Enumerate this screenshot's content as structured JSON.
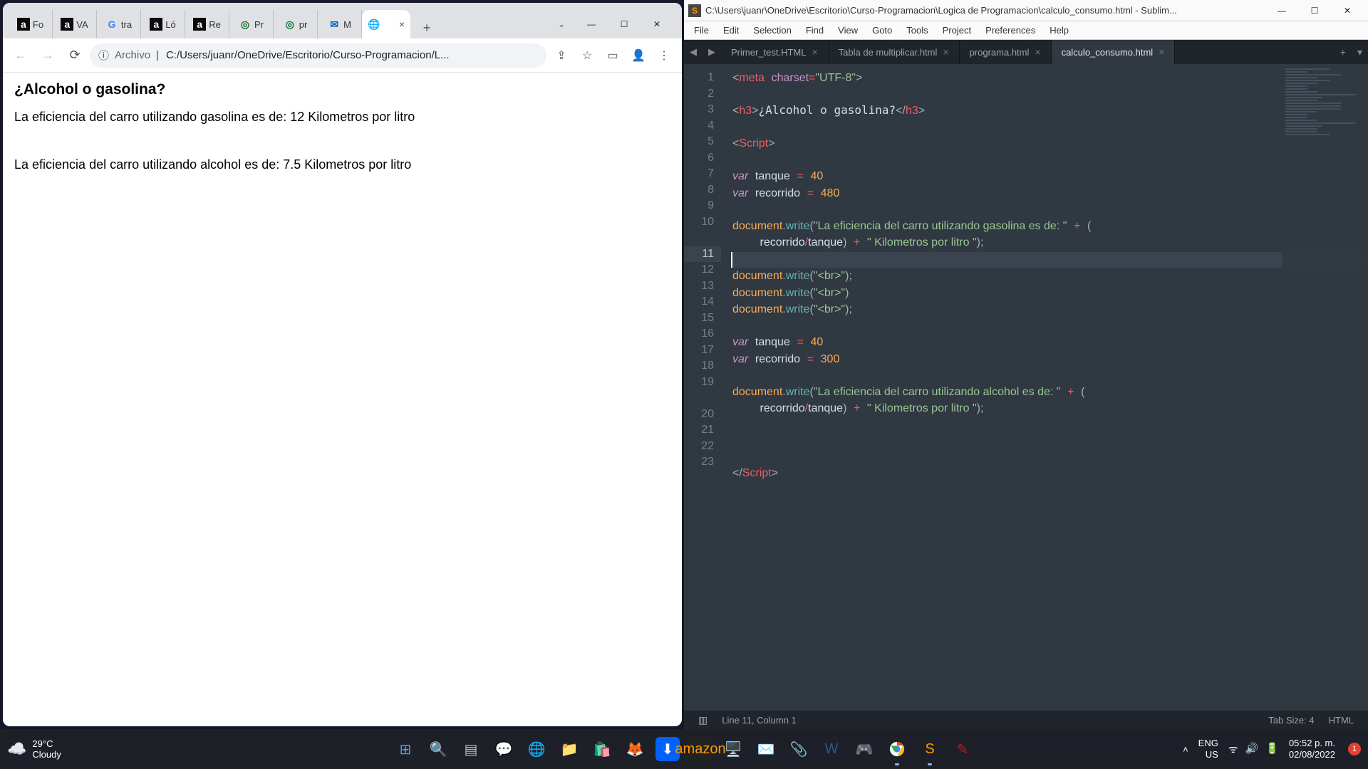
{
  "chrome": {
    "tabs": [
      {
        "icon": "a",
        "cls": "fav-a",
        "label": "Fo"
      },
      {
        "icon": "a",
        "cls": "fav-a",
        "label": "VA"
      },
      {
        "icon": "G",
        "cls": "fav-g",
        "label": "tra"
      },
      {
        "icon": "a",
        "cls": "fav-a",
        "label": "Ló"
      },
      {
        "icon": "a",
        "cls": "fav-a",
        "label": "Re"
      },
      {
        "icon": "◎",
        "cls": "fav-target",
        "label": "Pr"
      },
      {
        "icon": "◎",
        "cls": "fav-target",
        "label": "pr"
      },
      {
        "icon": "✉",
        "cls": "fav-outlook",
        "label": "M"
      }
    ],
    "active_tab_icon": "🌐",
    "active_tab_label": "",
    "url_label": "Archivo",
    "url_path": "C:/Users/juanr/OneDrive/Escritorio/Curso-Programacion/L...",
    "page": {
      "heading": "¿Alcohol o gasolina?",
      "line1": "La eficiencia del carro utilizando gasolina es de: 12 Kilometros por litro",
      "line2": "La eficiencia del carro utilizando alcohol es de: 7.5 Kilometros por litro"
    }
  },
  "sublime": {
    "title_path": "C:\\Users\\juanr\\OneDrive\\Escritorio\\Curso-Programacion\\Logica de Programacion\\calculo_consumo.html - Sublim...",
    "menu": [
      "File",
      "Edit",
      "Selection",
      "Find",
      "View",
      "Goto",
      "Tools",
      "Project",
      "Preferences",
      "Help"
    ],
    "tabs": [
      {
        "label": "Primer_test.HTML",
        "active": false
      },
      {
        "label": "Tabla de multiplicar.html",
        "active": false
      },
      {
        "label": "programa.html",
        "active": false
      },
      {
        "label": "calculo_consumo.html",
        "active": true
      }
    ],
    "line_numbers": [
      1,
      2,
      3,
      4,
      5,
      6,
      7,
      8,
      9,
      10,
      "",
      11,
      12,
      13,
      14,
      15,
      16,
      17,
      18,
      19,
      "",
      20,
      21,
      22,
      23
    ],
    "current_line_index": 11,
    "status": {
      "cursor": "Line 11, Column 1",
      "tabsize": "Tab Size: 4",
      "syntax": "HTML"
    },
    "code": {
      "meta_charset": "UTF-8",
      "h3_text": "¿Alcohol o gasolina?",
      "tanque1": "40",
      "recorrido1": "480",
      "gas_string_a": "\"La eficiencia del carro utilizando gasolina es de: \"",
      "km_string": "\" Kilometros por litro \"",
      "tanque2": "40",
      "recorrido2": "300",
      "alc_string_a": "\"La eficiencia del carro utilizando alcohol es de: \"",
      "br_string": "\"<br>\""
    }
  },
  "taskbar": {
    "weather_temp": "29°C",
    "weather_desc": "Cloudy",
    "lang1": "ENG",
    "lang2": "US",
    "time": "05:52 p. m.",
    "date": "02/08/2022",
    "notif_count": "1"
  }
}
